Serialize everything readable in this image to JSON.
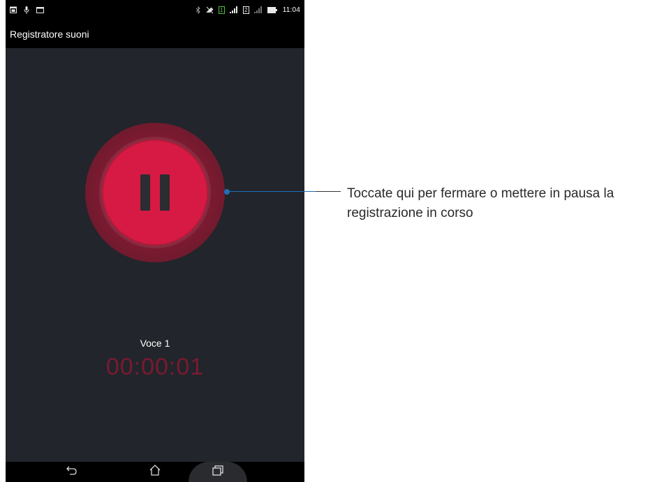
{
  "status_bar": {
    "left_icons": [
      "calendar-icon",
      "microphone-icon",
      "window-icon"
    ],
    "right_icons": [
      "bluetooth-icon",
      "no-sound-icon",
      "sim1-icon",
      "signal-icon",
      "sim2-icon",
      "signal-weak-icon",
      "battery-icon"
    ],
    "sim1_label": "1",
    "sim2_label": "2",
    "time": "11:04"
  },
  "app_bar": {
    "title": "Registratore suoni"
  },
  "recorder": {
    "state": "recording",
    "recording_name": "Voce 1",
    "elapsed_time": "00:00:01"
  },
  "nav_bar": {
    "buttons": [
      "back-icon",
      "home-icon",
      "recent-apps-icon"
    ]
  },
  "annotation": {
    "text": "Toccate qui per fermare o mettere in pausa la registrazione in corso"
  },
  "colors": {
    "screen_background": "#22252b",
    "record_button": "#d61a44",
    "record_ring": "#7d1a30",
    "timer_text": "#7a1a30",
    "callout_line": "#1f6fb8"
  }
}
